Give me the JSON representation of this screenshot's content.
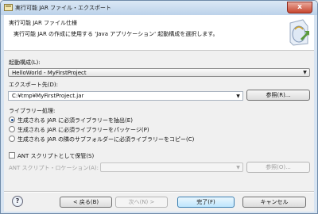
{
  "window": {
    "title": "実行可能 JAR ファイル・エクスポート",
    "close_label": "x"
  },
  "banner": {
    "title": "実行可能 JAR ファイル仕様",
    "description": "実行可能 JAR の作成に使用する 'Java アプリケーション' 起動構成を選択します。"
  },
  "launch_config": {
    "label": "起動構成(L):",
    "value": "HelloWorld - MyFirstProject"
  },
  "export_dest": {
    "label": "エクスポート先(D):",
    "value": "C:¥tmp¥MyFirstProject.jar",
    "browse_label": "参照(R)..."
  },
  "library_handling": {
    "label": "ライブラリー処理:",
    "options": [
      {
        "label": "生成される JAR に必須ライブラリーを抽出(E)",
        "selected": true
      },
      {
        "label": "生成される JAR に必須ライブラリーをパッケージ(P)",
        "selected": false
      },
      {
        "label": "生成される JAR の隣のサブフォルダーに必須ライブラリーをコピー(C)",
        "selected": false
      }
    ]
  },
  "ant": {
    "save_label": "ANT スクリプトとして保管(S)",
    "save_checked": false,
    "location_label": "ANT スクリプト・ロケーション(A):",
    "browse_label": "参照(O)..."
  },
  "footer": {
    "help_icon": "?",
    "back_label": "< 戻る(B)",
    "next_label": "次へ(N) >",
    "finish_label": "完了(F)",
    "cancel_label": "キャンセル"
  }
}
